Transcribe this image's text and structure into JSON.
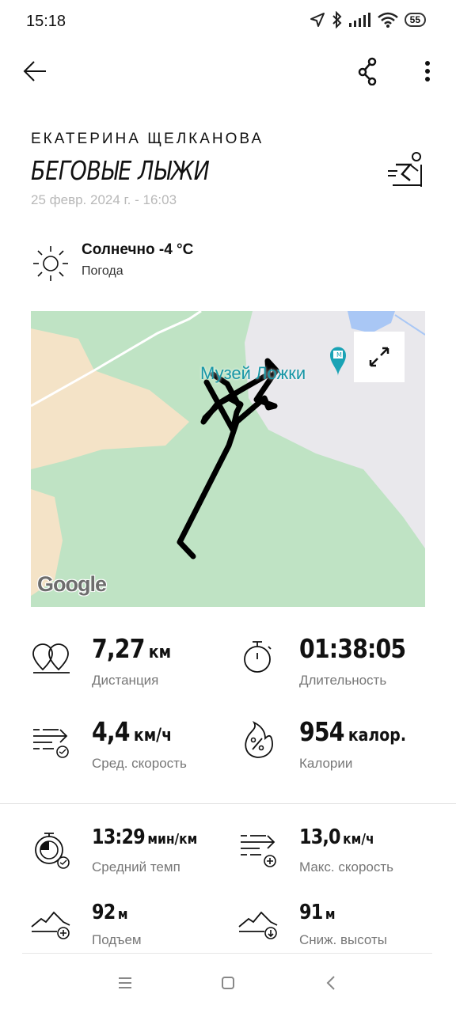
{
  "status_bar": {
    "time": "15:18",
    "battery": "55"
  },
  "header": {
    "back_icon": "arrow-left-icon",
    "share_icon": "share-icon",
    "menu_icon": "more-vert-icon"
  },
  "workout": {
    "owner": "ЕКАТЕРИНА ЩЕЛКАНОВА",
    "type": "БЕГОВЫЕ ЛЫЖИ",
    "datetime": "25 февр. 2024 г. - 16:03",
    "activity_icon": "skiing-icon"
  },
  "weather": {
    "title": "Солнечно -4 °C",
    "subtitle": "Погода",
    "icon": "sun-icon"
  },
  "map": {
    "poi_label": "Музей Ложки",
    "provider": "Google",
    "route_color": "#000000",
    "forest_color": "#bfe3c4",
    "field_color": "#f4e3c7",
    "water_color": "#a9c7f5"
  },
  "primary_stats": [
    {
      "value": "7,27",
      "unit": "км",
      "label": "Дистанция",
      "icon": "distance-icon"
    },
    {
      "value": "01:38:05",
      "unit": "",
      "label": "Длительность",
      "icon": "stopwatch-icon"
    },
    {
      "value": "4,4",
      "unit": "км/ч",
      "label": "Сред. скорость",
      "icon": "avg-speed-icon"
    },
    {
      "value": "954",
      "unit": "калор.",
      "label": "Калории",
      "icon": "calories-icon"
    }
  ],
  "secondary_stats": [
    {
      "value": "13:29",
      "unit": "мин/км",
      "label": "Средний темп",
      "icon": "pace-icon"
    },
    {
      "value": "13,0",
      "unit": "км/ч",
      "label": "Макс. скорость",
      "icon": "max-speed-icon"
    },
    {
      "value": "92",
      "unit": "м",
      "label": "Подъем",
      "icon": "ascent-icon"
    },
    {
      "value": "91",
      "unit": "м",
      "label": "Сниж. высоты",
      "icon": "descent-icon"
    }
  ],
  "navbar": {
    "menu_icon": "menu-icon",
    "home_icon": "home-icon",
    "back_icon": "nav-back-icon"
  }
}
